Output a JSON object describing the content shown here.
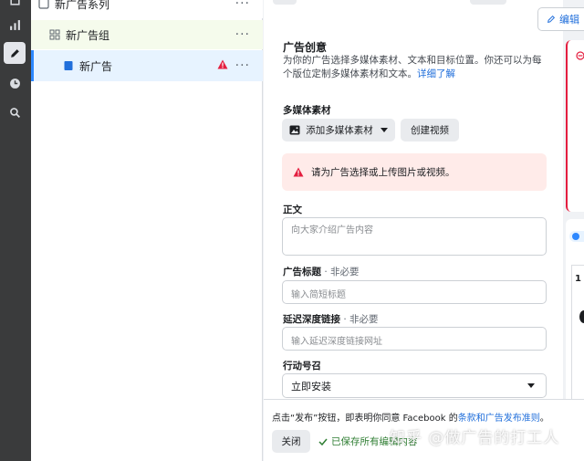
{
  "tree": {
    "campaign_label": "新广告系列",
    "adset_label": "新广告组",
    "ad_label": "新广告",
    "more_label": "···"
  },
  "creative": {
    "title": "广告创意",
    "description": "为你的广告选择多媒体素材、文本和目标位置。你还可以为每个版位定制多媒体素材和文本。",
    "learn_more": "详细了解"
  },
  "media": {
    "label": "多媒体素材",
    "add_button": "添加多媒体素材",
    "create_video_button": "创建视频",
    "alert": "请为广告选择或上传图片或视频。"
  },
  "fields": {
    "primary_text_label": "正文",
    "primary_text_placeholder": "向大家介绍广告内容",
    "headline_label": "广告标题",
    "headline_optional": " · 非必要",
    "headline_placeholder": "输入简短标题",
    "deeplink_label": "延迟深度链接",
    "deeplink_optional": " · 非必要",
    "deeplink_placeholder": "输入延迟深度链接网址",
    "cta_label": "行动号召",
    "cta_value": "立即安装"
  },
  "footer": {
    "agree_prefix": "点击“发布”按钮，即表明你同意 Facebook 的",
    "agree_link": "条款和广告发布准则",
    "agree_suffix": "。",
    "close_button": "关闭",
    "saved_text": "已保存所有编辑内容",
    "watermark": "知乎 @做广告的打工人"
  },
  "preview": {
    "edit_button": "编辑",
    "number": "1"
  },
  "colors": {
    "accent": "#216fdb",
    "alert_bg": "#ffebe9",
    "error": "#e41e3f",
    "saved": "#2e7d32"
  }
}
